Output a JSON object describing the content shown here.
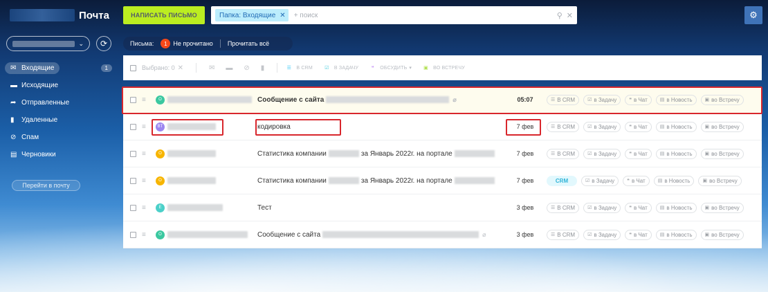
{
  "header": {
    "logo_title": "Почта",
    "compose_label": "НАПИСАТЬ ПИСЬМО",
    "search": {
      "folder_tag": "Папка: Входящие",
      "placeholder": "+ поиск"
    }
  },
  "sidebar": {
    "items": [
      {
        "label": "Входящие",
        "count": "1",
        "icon": "envelope-icon"
      },
      {
        "label": "Исходящие",
        "icon": "folder-icon"
      },
      {
        "label": "Отправленные",
        "icon": "sent-icon"
      },
      {
        "label": "Удаленные",
        "icon": "trash-icon"
      },
      {
        "label": "Спам",
        "icon": "spam-icon"
      },
      {
        "label": "Черновики",
        "icon": "draft-icon"
      }
    ],
    "go_to_mail": "Перейти в почту"
  },
  "filter": {
    "label": "Письма:",
    "unread_count": "1",
    "unread_label": "Не прочитано",
    "read_all": "Прочитать всё"
  },
  "toolbar": {
    "selected_label": "Выбрано: 0",
    "actions": [
      {
        "label": "В CRM",
        "color": "#2fc6f6"
      },
      {
        "label": "В ЗАДАЧУ",
        "color": "#55d0e0"
      },
      {
        "label": "ОБСУДИТЬ",
        "color": "#c693f5"
      },
      {
        "label": "ВО ВСТРЕЧУ",
        "color": "#b1e051"
      }
    ]
  },
  "row_actions": {
    "crm": "В CRM",
    "crm_added": "CRM",
    "task": "в Задачу",
    "chat": "в Чат",
    "news": "в Новость",
    "meeting": "во Встречу"
  },
  "messages": [
    {
      "avatar": "O",
      "avatar_color": "#3bc8a0",
      "subject": "Сообщение с сайта",
      "date": "05:07",
      "bold": true,
      "attachment": true,
      "crm_added": false
    },
    {
      "avatar": "BT",
      "avatar_color": "#9c86f0",
      "subject": "кодировка",
      "date": "7 фев",
      "bold": false,
      "attachment": false,
      "crm_added": false
    },
    {
      "avatar": "O",
      "avatar_color": "#f7b500",
      "subject_pre": "Статистика компании",
      "subject_post": "за Январь 2022г. на портале",
      "date": "7 фев",
      "bold": false,
      "attachment": false,
      "crm_added": false
    },
    {
      "avatar": "O",
      "avatar_color": "#f7b500",
      "subject_pre": "Статистика компании",
      "subject_post": "за Январь 2022г. на портале",
      "date": "7 фев",
      "bold": false,
      "attachment": false,
      "crm_added": true
    },
    {
      "avatar": "E",
      "avatar_color": "#4bd0c9",
      "subject": "Тест",
      "date": "3 фев",
      "bold": false,
      "attachment": false,
      "crm_added": false
    },
    {
      "avatar": "O",
      "avatar_color": "#3bc8a0",
      "subject": "Сообщение с сайта",
      "date": "3 фев",
      "bold": false,
      "attachment": true,
      "crm_added": false
    }
  ]
}
